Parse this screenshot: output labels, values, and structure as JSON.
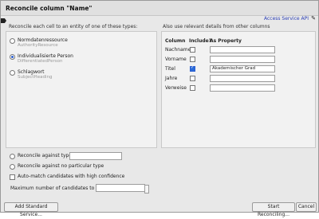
{
  "dialog": {
    "title": "Reconcile column \"Name\"",
    "access_link": "Access Service API"
  },
  "left": {
    "hint": "Reconcile each cell to an entity of one of these types:",
    "types": [
      {
        "name": "Normdatenressource",
        "id": "AuthorityResource",
        "checked": false
      },
      {
        "name": "Individualisierte Person",
        "id": "DifferentiatedPerson",
        "checked": true
      },
      {
        "name": "Schlagwort",
        "id": "SubjectHeading",
        "checked": false
      }
    ]
  },
  "right": {
    "hint": "Also use relevant details from other columns",
    "headers": {
      "column": "Column",
      "include": "Include?",
      "as_property": "As Property"
    },
    "rows": [
      {
        "name": "Nachname",
        "include": false,
        "property": ""
      },
      {
        "name": "Vorname",
        "include": false,
        "property": ""
      },
      {
        "name": "Titel",
        "include": true,
        "property": "Akademischer Grad"
      },
      {
        "name": "Jahre",
        "include": false,
        "property": ""
      },
      {
        "name": "Verweise",
        "include": false,
        "property": ""
      }
    ]
  },
  "options": {
    "against_type": "Reconcile against type:",
    "no_type": "Reconcile against no particular type",
    "auto_match": "Auto-match candidates with high confidence",
    "max_candidates": "Maximum number of candidates to return"
  },
  "buttons": {
    "add_service": "Add Standard Service...",
    "start": "Start Reconciling...",
    "cancel": "Cancel"
  }
}
